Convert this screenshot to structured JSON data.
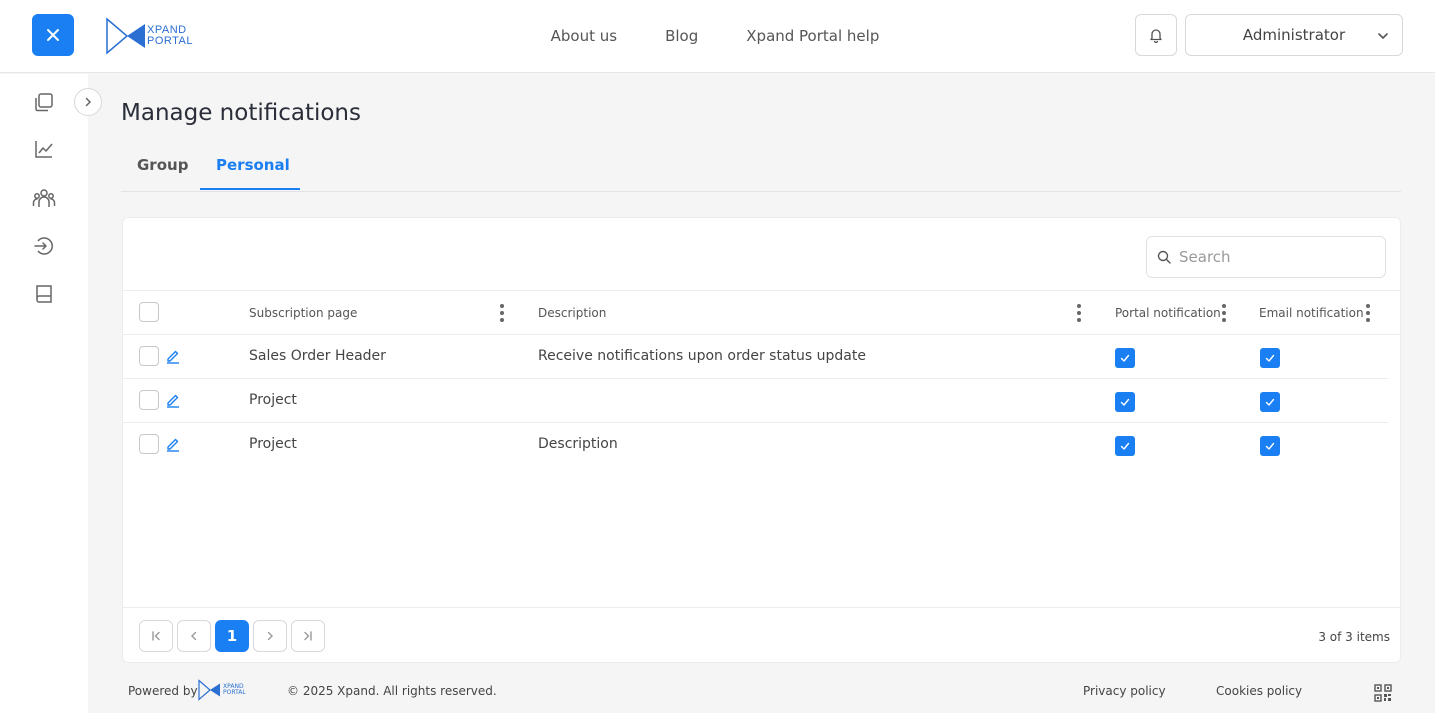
{
  "header": {
    "logo": {
      "line1": "XPAND",
      "line2": "PORTAL"
    },
    "nav": [
      {
        "label": "About us"
      },
      {
        "label": "Blog"
      },
      {
        "label": "Xpand Portal help"
      }
    ],
    "user": {
      "label": "Administrator"
    },
    "accent_color": "#1a7ff2"
  },
  "sidebar": {
    "icons": [
      "documents-icon",
      "chart-line-icon",
      "users-icon",
      "sign-in-icon",
      "book-icon"
    ]
  },
  "page": {
    "title": "Manage notifications",
    "tabs": [
      {
        "label": "Group",
        "active": false
      },
      {
        "label": "Personal",
        "active": true
      }
    ]
  },
  "table": {
    "search_placeholder": "Search",
    "columns": [
      "Subscription page",
      "Description",
      "Portal notification",
      "Email notification"
    ],
    "rows": [
      {
        "page": "Sales Order Header",
        "description": "Receive notifications upon order status update",
        "portal": true,
        "email": true
      },
      {
        "page": "Project",
        "description": "",
        "portal": true,
        "email": true
      },
      {
        "page": "Project",
        "description": "Description",
        "portal": true,
        "email": true
      }
    ]
  },
  "pager": {
    "current_page": "1",
    "summary": "3 of 3 items"
  },
  "footer": {
    "powered_by": "Powered by",
    "logo": {
      "line1": "XPAND",
      "line2": "PORTAL"
    },
    "copyright": "© 2025 Xpand. All rights reserved.",
    "privacy": "Privacy policy",
    "cookies": "Cookies policy"
  }
}
